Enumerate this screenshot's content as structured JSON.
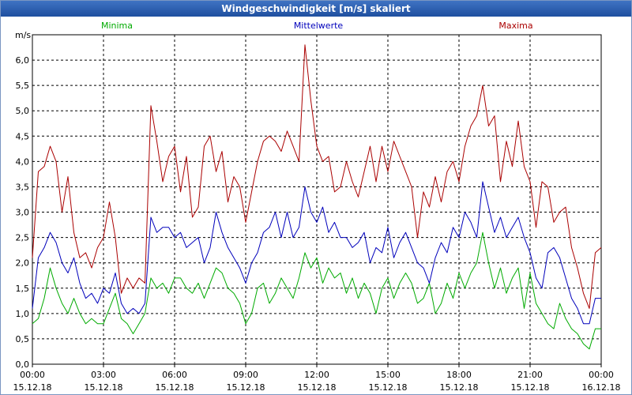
{
  "window": {
    "title": "Windgeschwindigkeit [m/s] skaliert"
  },
  "chart_data": {
    "type": "line",
    "title": "Windgeschwindigkeit [m/s] skaliert",
    "ylabel": "m/s",
    "ylim": [
      0,
      6.5
    ],
    "xlim": [
      0,
      24
    ],
    "grid": true,
    "legend": "top",
    "y_ticks": [
      "0,0",
      "0,5",
      "1,0",
      "1,5",
      "2,0",
      "2,5",
      "3,0",
      "3,5",
      "4,0",
      "4,5",
      "5,0",
      "5,5",
      "6,0"
    ],
    "x_ticks": [
      {
        "time": "00:00",
        "date": "15.12.18"
      },
      {
        "time": "03:00",
        "date": "15.12.18"
      },
      {
        "time": "06:00",
        "date": "15.12.18"
      },
      {
        "time": "09:00",
        "date": "15.12.18"
      },
      {
        "time": "12:00",
        "date": "15.12.18"
      },
      {
        "time": "15:00",
        "date": "15.12.18"
      },
      {
        "time": "18:00",
        "date": "15.12.18"
      },
      {
        "time": "21:00",
        "date": "15.12.18"
      },
      {
        "time": "00:00",
        "date": "16.12.18"
      }
    ],
    "x_unit": "hours",
    "series": [
      {
        "name": "Minima",
        "color": "#00aa00",
        "points": [
          [
            0.0,
            0.8
          ],
          [
            0.25,
            0.9
          ],
          [
            0.5,
            1.3
          ],
          [
            0.75,
            1.9
          ],
          [
            1.0,
            1.5
          ],
          [
            1.25,
            1.2
          ],
          [
            1.5,
            1.0
          ],
          [
            1.75,
            1.3
          ],
          [
            2.0,
            1.0
          ],
          [
            2.25,
            0.8
          ],
          [
            2.5,
            0.9
          ],
          [
            2.75,
            0.8
          ],
          [
            3.0,
            0.8
          ],
          [
            3.25,
            1.1
          ],
          [
            3.5,
            1.4
          ],
          [
            3.75,
            0.9
          ],
          [
            4.0,
            0.8
          ],
          [
            4.25,
            0.6
          ],
          [
            4.5,
            0.8
          ],
          [
            4.75,
            1.0
          ],
          [
            5.0,
            1.7
          ],
          [
            5.25,
            1.5
          ],
          [
            5.5,
            1.6
          ],
          [
            5.75,
            1.4
          ],
          [
            6.0,
            1.7
          ],
          [
            6.25,
            1.7
          ],
          [
            6.5,
            1.5
          ],
          [
            6.75,
            1.4
          ],
          [
            7.0,
            1.6
          ],
          [
            7.25,
            1.3
          ],
          [
            7.5,
            1.6
          ],
          [
            7.75,
            1.9
          ],
          [
            8.0,
            1.8
          ],
          [
            8.25,
            1.5
          ],
          [
            8.5,
            1.4
          ],
          [
            8.75,
            1.2
          ],
          [
            9.0,
            0.8
          ],
          [
            9.25,
            1.0
          ],
          [
            9.5,
            1.5
          ],
          [
            9.75,
            1.6
          ],
          [
            10.0,
            1.2
          ],
          [
            10.25,
            1.4
          ],
          [
            10.5,
            1.7
          ],
          [
            10.75,
            1.5
          ],
          [
            11.0,
            1.3
          ],
          [
            11.25,
            1.7
          ],
          [
            11.5,
            2.2
          ],
          [
            11.75,
            1.9
          ],
          [
            12.0,
            2.1
          ],
          [
            12.25,
            1.6
          ],
          [
            12.5,
            1.9
          ],
          [
            12.75,
            1.7
          ],
          [
            13.0,
            1.8
          ],
          [
            13.25,
            1.4
          ],
          [
            13.5,
            1.7
          ],
          [
            13.75,
            1.3
          ],
          [
            14.0,
            1.6
          ],
          [
            14.25,
            1.4
          ],
          [
            14.5,
            1.0
          ],
          [
            14.75,
            1.5
          ],
          [
            15.0,
            1.7
          ],
          [
            15.25,
            1.3
          ],
          [
            15.5,
            1.6
          ],
          [
            15.75,
            1.8
          ],
          [
            16.0,
            1.6
          ],
          [
            16.25,
            1.2
          ],
          [
            16.5,
            1.3
          ],
          [
            16.75,
            1.6
          ],
          [
            17.0,
            1.0
          ],
          [
            17.25,
            1.2
          ],
          [
            17.5,
            1.6
          ],
          [
            17.75,
            1.3
          ],
          [
            18.0,
            1.8
          ],
          [
            18.25,
            1.5
          ],
          [
            18.5,
            1.8
          ],
          [
            18.75,
            2.0
          ],
          [
            19.0,
            2.6
          ],
          [
            19.25,
            2.0
          ],
          [
            19.5,
            1.5
          ],
          [
            19.75,
            1.9
          ],
          [
            20.0,
            1.4
          ],
          [
            20.25,
            1.7
          ],
          [
            20.5,
            1.9
          ],
          [
            20.75,
            1.1
          ],
          [
            21.0,
            1.8
          ],
          [
            21.25,
            1.2
          ],
          [
            21.5,
            1.0
          ],
          [
            21.75,
            0.8
          ],
          [
            22.0,
            0.7
          ],
          [
            22.25,
            1.2
          ],
          [
            22.5,
            0.9
          ],
          [
            22.75,
            0.7
          ],
          [
            23.0,
            0.6
          ],
          [
            23.25,
            0.4
          ],
          [
            23.5,
            0.3
          ],
          [
            23.75,
            0.7
          ],
          [
            24.0,
            0.7
          ]
        ]
      },
      {
        "name": "Mittelwerte",
        "color": "#0000bb",
        "points": [
          [
            0.0,
            1.1
          ],
          [
            0.25,
            2.1
          ],
          [
            0.5,
            2.3
          ],
          [
            0.75,
            2.6
          ],
          [
            1.0,
            2.4
          ],
          [
            1.25,
            2.0
          ],
          [
            1.5,
            1.8
          ],
          [
            1.75,
            2.1
          ],
          [
            2.0,
            1.6
          ],
          [
            2.25,
            1.3
          ],
          [
            2.5,
            1.4
          ],
          [
            2.75,
            1.2
          ],
          [
            3.0,
            1.5
          ],
          [
            3.25,
            1.4
          ],
          [
            3.5,
            1.8
          ],
          [
            3.75,
            1.2
          ],
          [
            4.0,
            1.0
          ],
          [
            4.25,
            1.1
          ],
          [
            4.5,
            1.0
          ],
          [
            4.75,
            1.2
          ],
          [
            5.0,
            2.9
          ],
          [
            5.25,
            2.6
          ],
          [
            5.5,
            2.7
          ],
          [
            5.75,
            2.7
          ],
          [
            6.0,
            2.5
          ],
          [
            6.25,
            2.6
          ],
          [
            6.5,
            2.3
          ],
          [
            6.75,
            2.4
          ],
          [
            7.0,
            2.5
          ],
          [
            7.25,
            2.0
          ],
          [
            7.5,
            2.3
          ],
          [
            7.75,
            3.0
          ],
          [
            8.0,
            2.6
          ],
          [
            8.25,
            2.3
          ],
          [
            8.5,
            2.1
          ],
          [
            8.75,
            1.9
          ],
          [
            9.0,
            1.6
          ],
          [
            9.25,
            2.0
          ],
          [
            9.5,
            2.2
          ],
          [
            9.75,
            2.6
          ],
          [
            10.0,
            2.7
          ],
          [
            10.25,
            3.0
          ],
          [
            10.5,
            2.5
          ],
          [
            10.75,
            3.0
          ],
          [
            11.0,
            2.5
          ],
          [
            11.25,
            2.7
          ],
          [
            11.5,
            3.5
          ],
          [
            11.75,
            3.0
          ],
          [
            12.0,
            2.8
          ],
          [
            12.25,
            3.1
          ],
          [
            12.5,
            2.6
          ],
          [
            12.75,
            2.8
          ],
          [
            13.0,
            2.5
          ],
          [
            13.25,
            2.5
          ],
          [
            13.5,
            2.3
          ],
          [
            13.75,
            2.4
          ],
          [
            14.0,
            2.6
          ],
          [
            14.25,
            2.0
          ],
          [
            14.5,
            2.3
          ],
          [
            14.75,
            2.2
          ],
          [
            15.0,
            2.7
          ],
          [
            15.25,
            2.1
          ],
          [
            15.5,
            2.4
          ],
          [
            15.75,
            2.6
          ],
          [
            16.0,
            2.3
          ],
          [
            16.25,
            2.0
          ],
          [
            16.5,
            1.9
          ],
          [
            16.75,
            1.6
          ],
          [
            17.0,
            2.1
          ],
          [
            17.25,
            2.4
          ],
          [
            17.5,
            2.2
          ],
          [
            17.75,
            2.7
          ],
          [
            18.0,
            2.5
          ],
          [
            18.25,
            3.0
          ],
          [
            18.5,
            2.8
          ],
          [
            18.75,
            2.5
          ],
          [
            19.0,
            3.6
          ],
          [
            19.25,
            3.1
          ],
          [
            19.5,
            2.6
          ],
          [
            19.75,
            2.9
          ],
          [
            20.0,
            2.5
          ],
          [
            20.25,
            2.7
          ],
          [
            20.5,
            2.9
          ],
          [
            20.75,
            2.5
          ],
          [
            21.0,
            2.2
          ],
          [
            21.25,
            1.7
          ],
          [
            21.5,
            1.5
          ],
          [
            21.75,
            2.2
          ],
          [
            22.0,
            2.3
          ],
          [
            22.25,
            2.1
          ],
          [
            22.5,
            1.7
          ],
          [
            22.75,
            1.3
          ],
          [
            23.0,
            1.1
          ],
          [
            23.25,
            0.8
          ],
          [
            23.5,
            0.8
          ],
          [
            23.75,
            1.3
          ],
          [
            24.0,
            1.3
          ]
        ]
      },
      {
        "name": "Maxima",
        "color": "#aa0000",
        "points": [
          [
            0.0,
            2.1
          ],
          [
            0.25,
            3.8
          ],
          [
            0.5,
            3.9
          ],
          [
            0.75,
            4.3
          ],
          [
            1.0,
            4.0
          ],
          [
            1.25,
            3.0
          ],
          [
            1.5,
            3.7
          ],
          [
            1.75,
            2.6
          ],
          [
            2.0,
            2.1
          ],
          [
            2.25,
            2.2
          ],
          [
            2.5,
            1.9
          ],
          [
            2.75,
            2.3
          ],
          [
            3.0,
            2.5
          ],
          [
            3.25,
            3.2
          ],
          [
            3.5,
            2.5
          ],
          [
            3.75,
            1.4
          ],
          [
            4.0,
            1.7
          ],
          [
            4.25,
            1.5
          ],
          [
            4.5,
            1.7
          ],
          [
            4.75,
            1.6
          ],
          [
            5.0,
            5.1
          ],
          [
            5.25,
            4.4
          ],
          [
            5.5,
            3.6
          ],
          [
            5.75,
            4.1
          ],
          [
            6.0,
            4.3
          ],
          [
            6.25,
            3.4
          ],
          [
            6.5,
            4.1
          ],
          [
            6.75,
            2.9
          ],
          [
            7.0,
            3.1
          ],
          [
            7.25,
            4.3
          ],
          [
            7.5,
            4.5
          ],
          [
            7.75,
            3.8
          ],
          [
            8.0,
            4.2
          ],
          [
            8.25,
            3.2
          ],
          [
            8.5,
            3.7
          ],
          [
            8.75,
            3.5
          ],
          [
            9.0,
            2.8
          ],
          [
            9.25,
            3.4
          ],
          [
            9.5,
            4.0
          ],
          [
            9.75,
            4.4
          ],
          [
            10.0,
            4.5
          ],
          [
            10.25,
            4.4
          ],
          [
            10.5,
            4.2
          ],
          [
            10.75,
            4.6
          ],
          [
            11.0,
            4.3
          ],
          [
            11.25,
            4.0
          ],
          [
            11.5,
            6.3
          ],
          [
            11.75,
            5.2
          ],
          [
            12.0,
            4.3
          ],
          [
            12.25,
            4.0
          ],
          [
            12.5,
            4.1
          ],
          [
            12.75,
            3.4
          ],
          [
            13.0,
            3.5
          ],
          [
            13.25,
            4.0
          ],
          [
            13.5,
            3.6
          ],
          [
            13.75,
            3.3
          ],
          [
            14.0,
            3.8
          ],
          [
            14.25,
            4.3
          ],
          [
            14.5,
            3.6
          ],
          [
            14.75,
            4.3
          ],
          [
            15.0,
            3.8
          ],
          [
            15.25,
            4.4
          ],
          [
            15.5,
            4.1
          ],
          [
            15.75,
            3.8
          ],
          [
            16.0,
            3.5
          ],
          [
            16.25,
            2.5
          ],
          [
            16.5,
            3.4
          ],
          [
            16.75,
            3.1
          ],
          [
            17.0,
            3.7
          ],
          [
            17.25,
            3.2
          ],
          [
            17.5,
            3.8
          ],
          [
            17.75,
            4.0
          ],
          [
            18.0,
            3.6
          ],
          [
            18.25,
            4.3
          ],
          [
            18.5,
            4.7
          ],
          [
            18.75,
            4.9
          ],
          [
            19.0,
            5.5
          ],
          [
            19.25,
            4.7
          ],
          [
            19.5,
            4.9
          ],
          [
            19.75,
            3.6
          ],
          [
            20.0,
            4.4
          ],
          [
            20.25,
            3.9
          ],
          [
            20.5,
            4.8
          ],
          [
            20.75,
            3.9
          ],
          [
            21.0,
            3.6
          ],
          [
            21.25,
            2.7
          ],
          [
            21.5,
            3.6
          ],
          [
            21.75,
            3.5
          ],
          [
            22.0,
            2.8
          ],
          [
            22.25,
            3.0
          ],
          [
            22.5,
            3.1
          ],
          [
            22.75,
            2.3
          ],
          [
            23.0,
            1.9
          ],
          [
            23.25,
            1.4
          ],
          [
            23.5,
            1.1
          ],
          [
            23.75,
            2.2
          ],
          [
            24.0,
            2.3
          ]
        ]
      }
    ]
  }
}
